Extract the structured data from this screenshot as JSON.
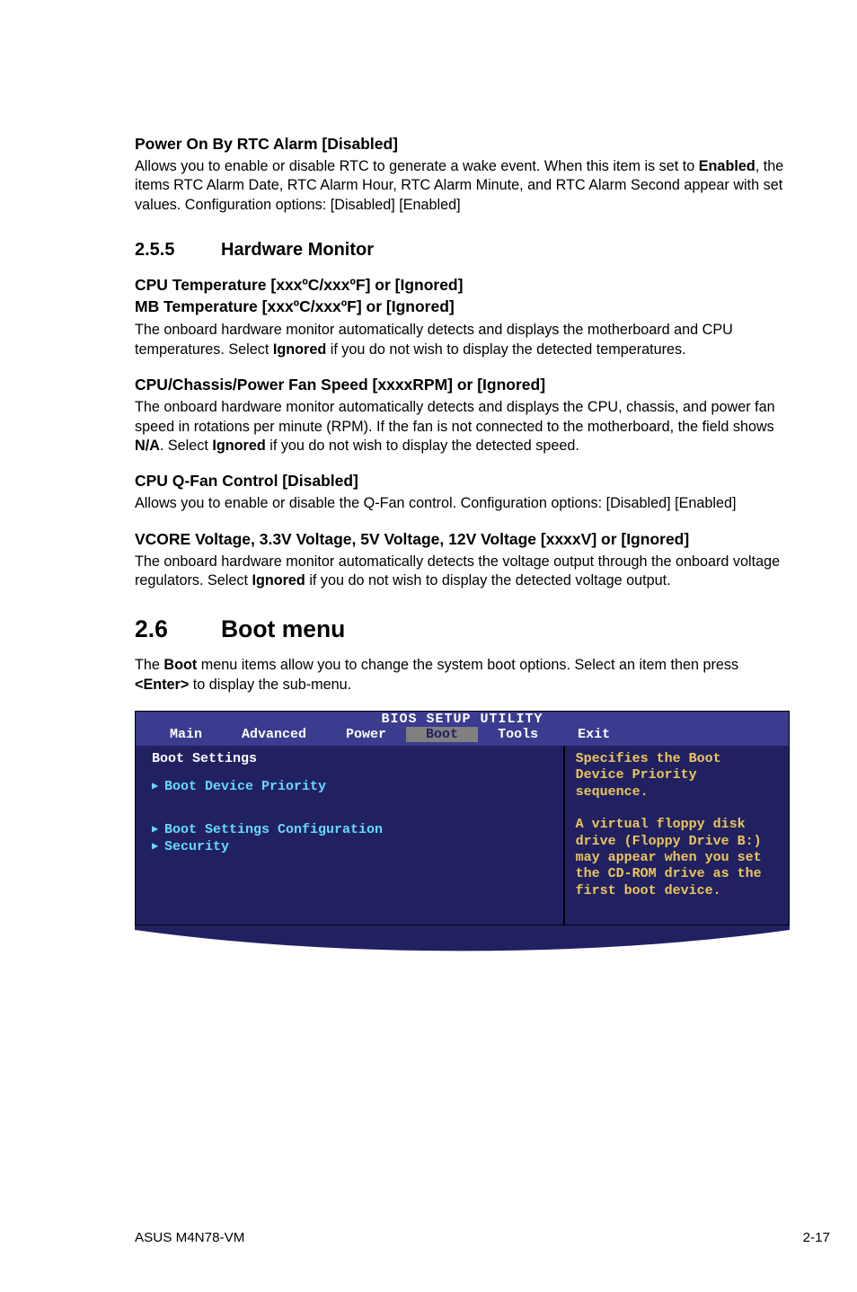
{
  "sections": {
    "pwr_rtc": {
      "heading": "Power On By RTC Alarm [Disabled]",
      "body": "Allows you to enable or disable RTC to generate a wake event. When this item is set to Enabled, the items RTC Alarm Date, RTC Alarm Hour, RTC Alarm Minute, and RTC Alarm Second appear with set values. Configuration options: [Disabled] [Enabled]"
    },
    "hw_monitor": {
      "num": "2.5.5",
      "title": "Hardware Monitor"
    },
    "cpu_temp": {
      "line1": "CPU Temperature [xxxºC/xxxºF] or [Ignored]",
      "line2": "MB Temperature [xxxºC/xxxºF] or [Ignored]",
      "body": "The onboard hardware monitor automatically detects and displays the motherboard and CPU temperatures. Select Ignored if you do not wish to display the detected temperatures."
    },
    "fan_speed": {
      "heading": "CPU/Chassis/Power Fan Speed [xxxxRPM] or [Ignored]",
      "body": "The onboard hardware monitor automatically detects and displays the CPU, chassis, and power fan speed in rotations per minute (RPM). If the fan is not connected to the motherboard, the field shows N/A. Select Ignored if you do not wish to display the detected speed."
    },
    "qfan": {
      "heading": "CPU Q-Fan Control [Disabled]",
      "body": "Allows you to enable or disable the Q-Fan control. Configuration options: [Disabled] [Enabled]"
    },
    "vcore": {
      "heading": "VCORE Voltage, 3.3V Voltage, 5V Voltage, 12V Voltage [xxxxV] or [Ignored]",
      "body": "The onboard hardware monitor automatically detects the voltage output through the onboard voltage regulators. Select Ignored if you do not wish to display the detected voltage output."
    },
    "boot_menu": {
      "num": "2.6",
      "title": "Boot menu",
      "body": "The Boot menu items allow you to change the system boot options. Select an item then press <Enter> to display the sub-menu."
    }
  },
  "bios": {
    "title": "BIOS SETUP UTILITY",
    "tabs": {
      "main": "Main",
      "advanced": "Advanced",
      "power": "Power",
      "boot": "Boot",
      "tools": "Tools",
      "exit": "Exit"
    },
    "left": {
      "heading": "Boot Settings",
      "item1": "Boot Device Priority",
      "item2": "Boot Settings Configuration",
      "item3": "Security"
    },
    "right": {
      "l1": "Specifies the Boot",
      "l2": "Device Priority",
      "l3": "sequence.",
      "l4": "",
      "l5": "A virtual floppy disk",
      "l6": "drive (Floppy Drive B:)",
      "l7": "may appear when you set",
      "l8": "the CD-ROM drive as the",
      "l9": "first boot device."
    }
  },
  "footer": {
    "left": "ASUS M4N78-VM",
    "right": "2-17"
  }
}
